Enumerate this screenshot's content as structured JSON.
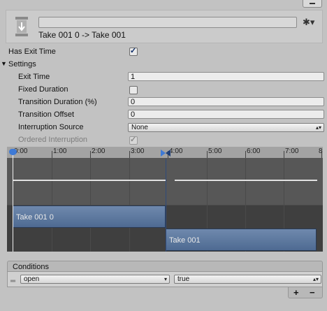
{
  "header": {
    "name_value": "",
    "title": "Take 001 0 -> Take 001"
  },
  "has_exit_time": {
    "label": "Has Exit Time",
    "checked": true
  },
  "settings": {
    "label": "Settings",
    "exit_time": {
      "label": "Exit Time",
      "value": "1"
    },
    "fixed_duration": {
      "label": "Fixed Duration",
      "checked": false
    },
    "transition_duration": {
      "label": "Transition Duration (%)",
      "value": "0"
    },
    "transition_offset": {
      "label": "Transition Offset",
      "value": "0"
    },
    "interruption_source": {
      "label": "Interruption Source",
      "value": "None"
    },
    "ordered_interruption": {
      "label": "Ordered Interruption",
      "checked": true
    }
  },
  "timeline": {
    "ticks": [
      "0:00",
      "1:00",
      "2:00",
      "3:00",
      "4:00",
      "5:00",
      "6:00",
      "7:00",
      "8"
    ],
    "source_clip": "Take 001 0",
    "dest_clip": "Take 001"
  },
  "conditions": {
    "label": "Conditions",
    "parameter": "open",
    "value": "true",
    "add_label": "+",
    "remove_label": "−"
  },
  "icons": {
    "settings": "gear-icon",
    "foldout": "triangle-down-icon",
    "state": "transition-icon"
  }
}
